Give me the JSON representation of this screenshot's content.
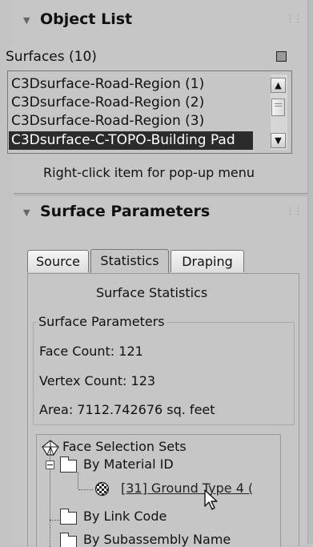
{
  "object_list": {
    "title": "Object List",
    "surfaces_label": "Surfaces (10)",
    "items": [
      "C3Dsurface-Road-Region (1)",
      "C3Dsurface-Road-Region (2)",
      "C3Dsurface-Road-Region (3)",
      "C3Dsurface-C-TOPO-Building Pad"
    ],
    "selected_index": 3,
    "hint": "Right-click item for pop-up menu"
  },
  "surface_parameters": {
    "title": "Surface Parameters",
    "tabs": [
      "Source",
      "Statistics",
      "Draping"
    ],
    "active_tab": "Statistics",
    "statistics": {
      "heading": "Surface Statistics",
      "group_label": "Surface Parameters",
      "face_count": "Face Count: 121",
      "vertex_count": "Vertex Count: 123",
      "area": "Area: 7112.742676 sq. feet"
    },
    "tree": {
      "root": "Face Selection Sets",
      "by_material": "By Material ID",
      "material_item": "[31] Ground Type 4 (",
      "by_link": "By Link Code",
      "by_subassembly": "By Subassembly Name"
    }
  },
  "icons": {
    "collapse": "triangle-down-icon",
    "grip": "grip-dots-icon",
    "scroll_up": "arrow-up-icon",
    "scroll_down": "arrow-down-icon",
    "folder": "folder-icon",
    "material": "checker-sphere-icon",
    "cursor": "mouse-pointer-icon",
    "root": "pyramid-icon"
  }
}
